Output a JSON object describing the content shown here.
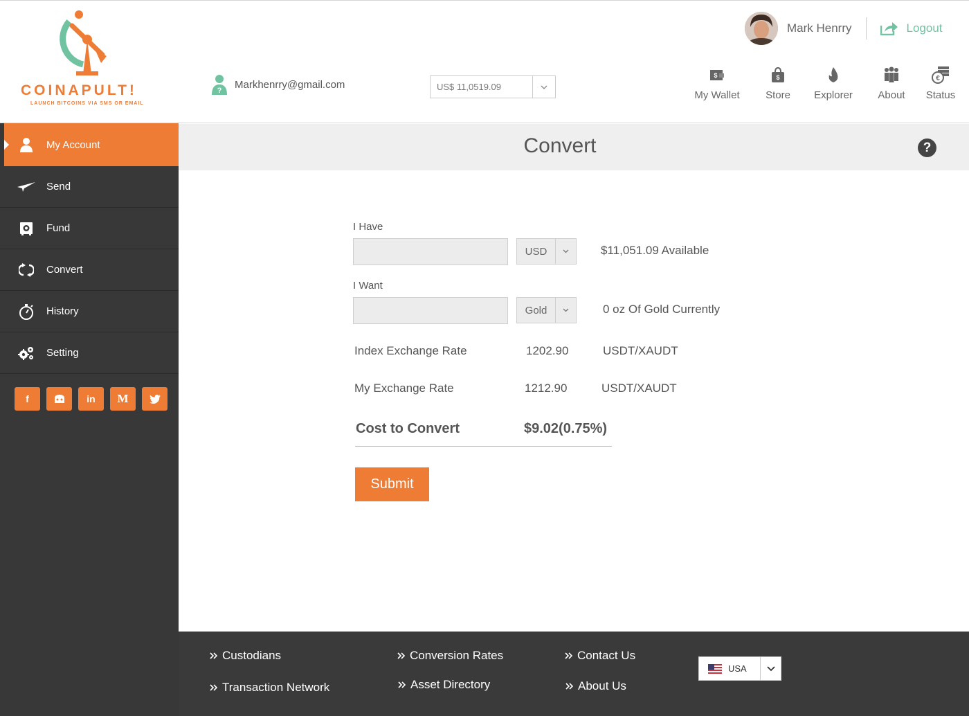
{
  "brand": {
    "name": "COINAPULT!",
    "tagline": "LAUNCH BITCOINS VIA SMS OR EMAIL",
    "accent": "#ef7c35",
    "green": "#6fc3a0"
  },
  "header": {
    "email": "Markhenrry@gmail.com",
    "balance_select": "US$ 11,0519.09",
    "user_name": "Mark Henrry",
    "logout_label": "Logout",
    "nav": [
      {
        "label": "My Wallet",
        "icon": "wallet-icon"
      },
      {
        "label": "Store",
        "icon": "shopping-bag-icon"
      },
      {
        "label": "Explorer",
        "icon": "flame-icon"
      },
      {
        "label": "About",
        "icon": "people-icon"
      },
      {
        "label": "Status",
        "icon": "coins-icon"
      }
    ]
  },
  "sidebar": {
    "items": [
      {
        "label": "My Account",
        "icon": "user-icon",
        "active": true
      },
      {
        "label": "Send",
        "icon": "paper-plane-icon"
      },
      {
        "label": "Fund",
        "icon": "safe-icon"
      },
      {
        "label": "Convert",
        "icon": "convert-icon"
      },
      {
        "label": "History",
        "icon": "stopwatch-icon"
      },
      {
        "label": "Setting",
        "icon": "gears-icon"
      }
    ],
    "social": [
      {
        "label": "f",
        "icon": "facebook-icon"
      },
      {
        "label": "",
        "icon": "github-icon"
      },
      {
        "label": "in",
        "icon": "linkedin-icon"
      },
      {
        "label": "M",
        "icon": "medium-icon"
      },
      {
        "label": "",
        "icon": "twitter-icon"
      }
    ]
  },
  "main": {
    "title": "Convert",
    "i_have_label": "I Have",
    "i_have_value": "",
    "i_have_currency": "USD",
    "available_text": "$11,051.09  Available",
    "i_want_label": "I Want",
    "i_want_value": "",
    "i_want_currency": "Gold",
    "current_text": "0 oz Of Gold Currently",
    "index_rate_label": "Index Exchange Rate",
    "index_rate_value": "1202.90",
    "index_rate_unit": "USDT/XAUDT",
    "my_rate_label": "My Exchange Rate",
    "my_rate_value": "1212.90",
    "my_rate_unit": "USDT/XAUDT",
    "cost_label": "Cost to Convert",
    "cost_value": "$9.02(0.75%)",
    "submit_label": "Submit"
  },
  "footer": {
    "links": [
      "Custodians",
      "Transaction Network",
      "Conversion Rates",
      "Asset Directory",
      "Contact Us",
      "About Us"
    ],
    "country": "USA"
  }
}
